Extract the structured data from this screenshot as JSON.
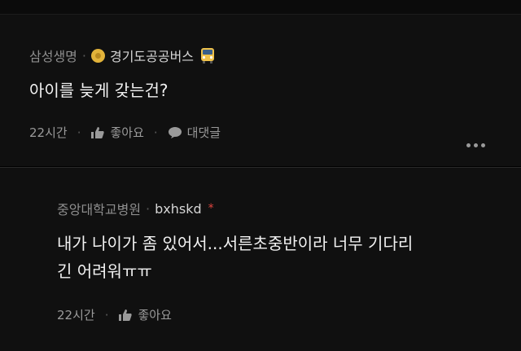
{
  "post": {
    "company": "삼성생명",
    "author": "경기도공공버스",
    "body": "아이를 늦게 갖는건?",
    "time": "22시간",
    "like_label": "좋아요",
    "reply_label": "대댓글"
  },
  "reply": {
    "company": "중앙대학교병원",
    "author": "bxhskd",
    "body_line1": "내가 나이가 좀 있어서...서른초중반이라 너무 기다리",
    "body_line2": "긴 어려워ㅠㅠ",
    "time": "22시간",
    "like_label": "좋아요"
  },
  "icons": {
    "company_badge": "gold-coin-icon",
    "author_badge": "bus-icon",
    "like": "thumbs-up-icon",
    "reply": "speech-bubble-icon",
    "more": "more-dots-icon",
    "op_marker": "asterisk-icon"
  },
  "colors": {
    "background": "#101010",
    "text": "#f2f2f2",
    "muted": "#8e8e8e",
    "accent_red": "#e0453f"
  }
}
